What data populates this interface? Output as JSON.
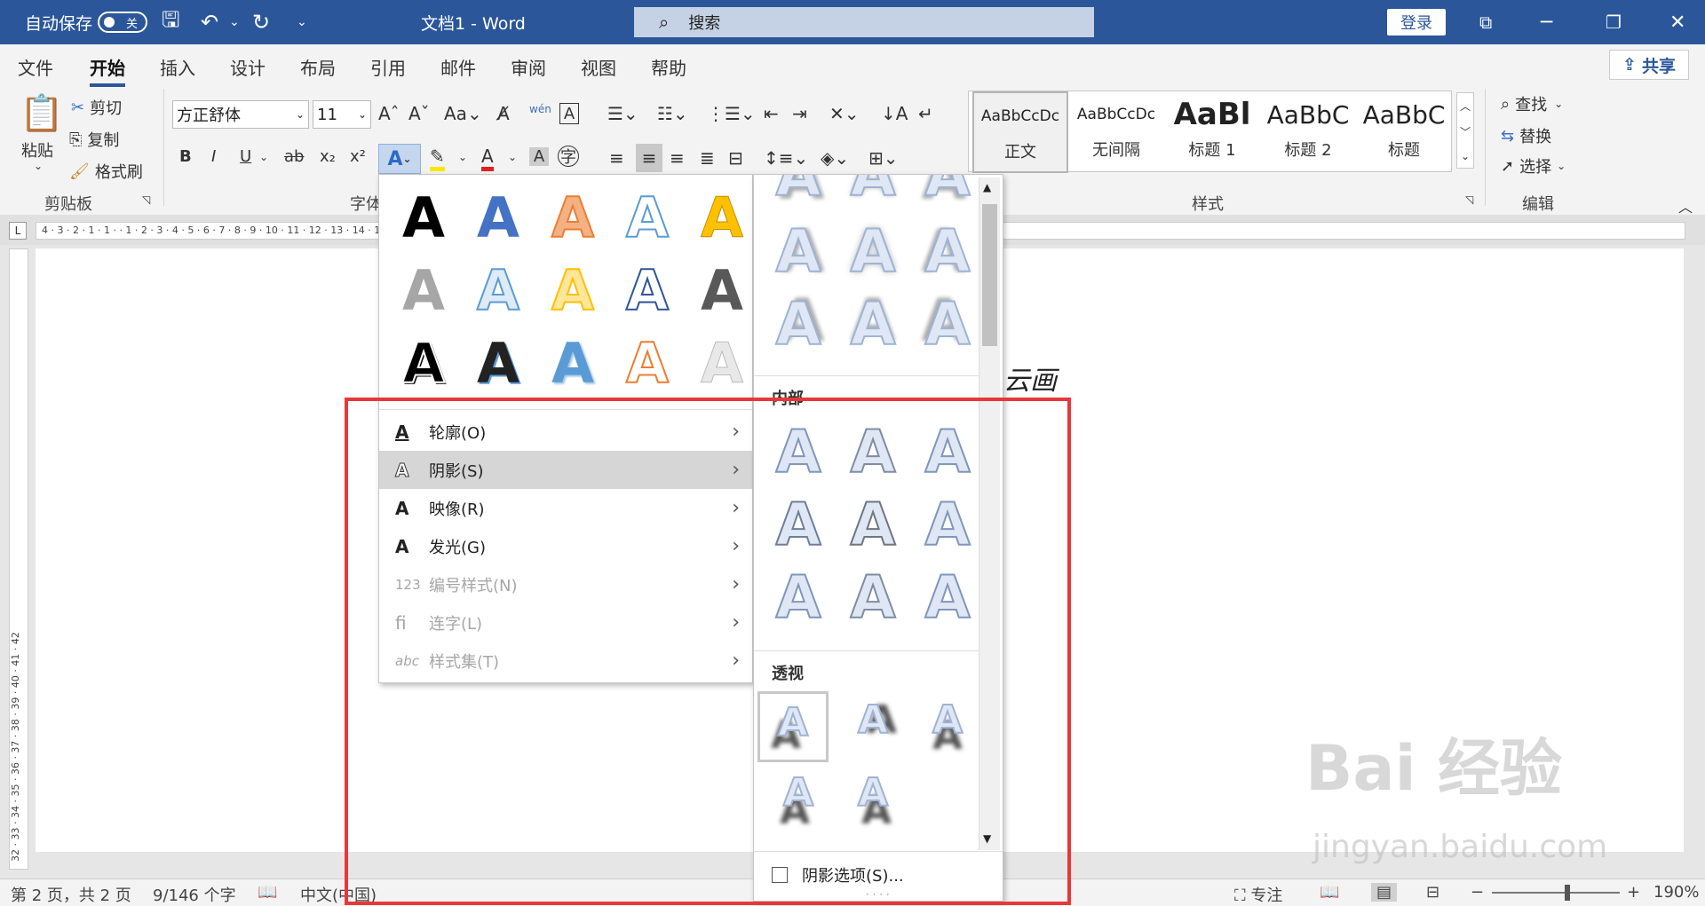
{
  "titlebar": {
    "autosave_label": "自动保存",
    "autosave_state": "关",
    "doc_title": "文档1  -  Word",
    "search_placeholder": "搜索",
    "login_label": "登录"
  },
  "tabs": [
    "文件",
    "开始",
    "插入",
    "设计",
    "布局",
    "引用",
    "邮件",
    "审阅",
    "视图",
    "帮助"
  ],
  "share_label": "共享",
  "clipboard": {
    "paste": "粘贴",
    "cut": "剪切",
    "copy": "复制",
    "format_painter": "格式刷",
    "group_label": "剪贴板"
  },
  "font": {
    "family": "方正舒体",
    "size": "11",
    "group_label": "字体",
    "bold": "B",
    "italic": "I",
    "underline": "U",
    "strike": "ab",
    "subscript": "x₂",
    "superscript": "x²"
  },
  "styles": {
    "group_label": "样式",
    "items": [
      {
        "preview": "AaBbCcDc",
        "name": "正文"
      },
      {
        "preview": "AaBbCcDc",
        "name": "无间隔"
      },
      {
        "preview": "AaBl",
        "name": "标题 1"
      },
      {
        "preview": "AaBbC",
        "name": "标题 2"
      },
      {
        "preview": "AaBbC",
        "name": "标题"
      }
    ]
  },
  "editing": {
    "find": "查找",
    "replace": "替换",
    "select": "选择",
    "group_label": "编辑"
  },
  "ruler": {
    "ticks": "4 · 3 · 2 · 1 · 1 ·  · 1 · 2 · 3 · 4 · 5 · 6 · 7 · 8 · 9 · 10 · 11 · 12 · 13 · 14 · 15 · 16 · 17 · 18 · 19 · 20 · 21 · 22 · 23 · 24 · 25 · 26 · 27 · 28 · 29 · 30 · 31 · 32 · 33 · 34 · 35 · 36 · 37 · 38 · 39 · 40 · 41 · 42",
    "vertical": "32 · 33 · 34 · 35 · 36 · 37 · 38 · 39 · 40 · 41 · 42"
  },
  "text_effects_menu": {
    "items": [
      {
        "label": "轮廓(O)",
        "icon": "A",
        "enabled": true
      },
      {
        "label": "阴影(S)",
        "icon": "A",
        "enabled": true,
        "highlighted": true
      },
      {
        "label": "映像(R)",
        "icon": "A",
        "enabled": true
      },
      {
        "label": "发光(G)",
        "icon": "A",
        "enabled": true
      },
      {
        "label": "编号样式(N)",
        "icon": "123",
        "enabled": false
      },
      {
        "label": "连字(L)",
        "icon": "ﬁ",
        "enabled": false
      },
      {
        "label": "样式集(T)",
        "icon": "abc",
        "enabled": false
      }
    ]
  },
  "shadow_submenu": {
    "section_inner": "内部",
    "section_perspective": "透视",
    "options_label": "阴影选项(S)..."
  },
  "doc_text_fragment": "云画",
  "status": {
    "page": "第 2 页，共 2 页",
    "words": "9/146 个字",
    "language": "中文(中国)",
    "focus": "专注",
    "zoom": "190%"
  },
  "watermark": {
    "brand": "Bai 经验",
    "url": "jingyan.baidu.com"
  },
  "colors": {
    "titlebar": "#2b579a",
    "highlight_red_box": "#e8373a"
  }
}
